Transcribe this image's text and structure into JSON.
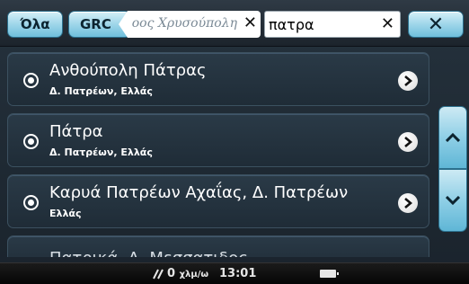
{
  "toolbar": {
    "all_label": "Όλα",
    "country_label": "GRC",
    "street_crumb": "οος Χρυσούπολη",
    "search": {
      "value": "πατρα",
      "placeholder": ""
    },
    "clear_icon": "close-icon",
    "close_icon": "close-icon"
  },
  "results": [
    {
      "title": "Ανθούπολη Πάτρας",
      "subtitle": "Δ. Πατρέων, Ελλάς"
    },
    {
      "title": "Πάτρα",
      "subtitle": "Δ. Πατρέων, Ελλάς"
    },
    {
      "title": "Καρυά Πατρέων Αχαΐας, Δ. Πατρέων",
      "subtitle": "Ελλάς"
    },
    {
      "title": "Πατρικά, Δ. Μεσσατιδος...",
      "subtitle": ""
    }
  ],
  "scroll": {
    "up_icon": "chevron-up-icon",
    "down_icon": "chevron-down-icon"
  },
  "status": {
    "speed_value": "0",
    "speed_unit": "χλμ/ω",
    "time": "13:01",
    "battery_icon": "battery-icon"
  },
  "colors": {
    "accent": "#8fcfe6",
    "background": "#1f2c37",
    "text": "#ffffff"
  }
}
